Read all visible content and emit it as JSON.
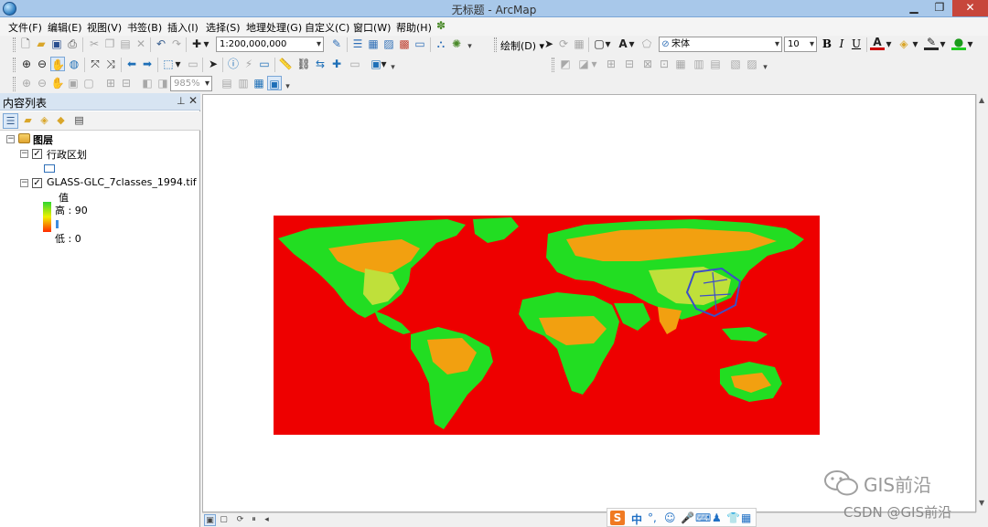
{
  "window": {
    "title": "无标题 - ArcMap"
  },
  "menus": [
    "文件(F)",
    "编辑(E)",
    "视图(V)",
    "书签(B)",
    "插入(I)",
    "选择(S)",
    "地理处理(G)",
    "自定义(C)",
    "窗口(W)",
    "帮助(H)"
  ],
  "toolbar": {
    "scale": "1:200,000,000",
    "draw_label": "绘制(D)",
    "font_name": "宋体",
    "font_size": "10",
    "bold": "B",
    "italic": "I",
    "underline": "U",
    "text_tool": "A",
    "zoom_percent": "985%"
  },
  "toc": {
    "title": "内容列表",
    "group": "图层",
    "layers": [
      {
        "name": "行政区划",
        "checked": true
      },
      {
        "name": "GLASS-GLC_7classes_1994.tif",
        "checked": true
      }
    ],
    "legend": {
      "field": "值",
      "high": "高 : 90",
      "low": "低 : 0"
    }
  },
  "ime": {
    "mode": "中"
  },
  "watermark": {
    "brand": "GIS前沿",
    "credit": "CSDN @GIS前沿"
  },
  "colors": {
    "ocean": "#ee0000",
    "forest": "#22dd22",
    "crop": "#f2a010",
    "grass": "#bfe03a",
    "admin": "#3c4fc8"
  }
}
